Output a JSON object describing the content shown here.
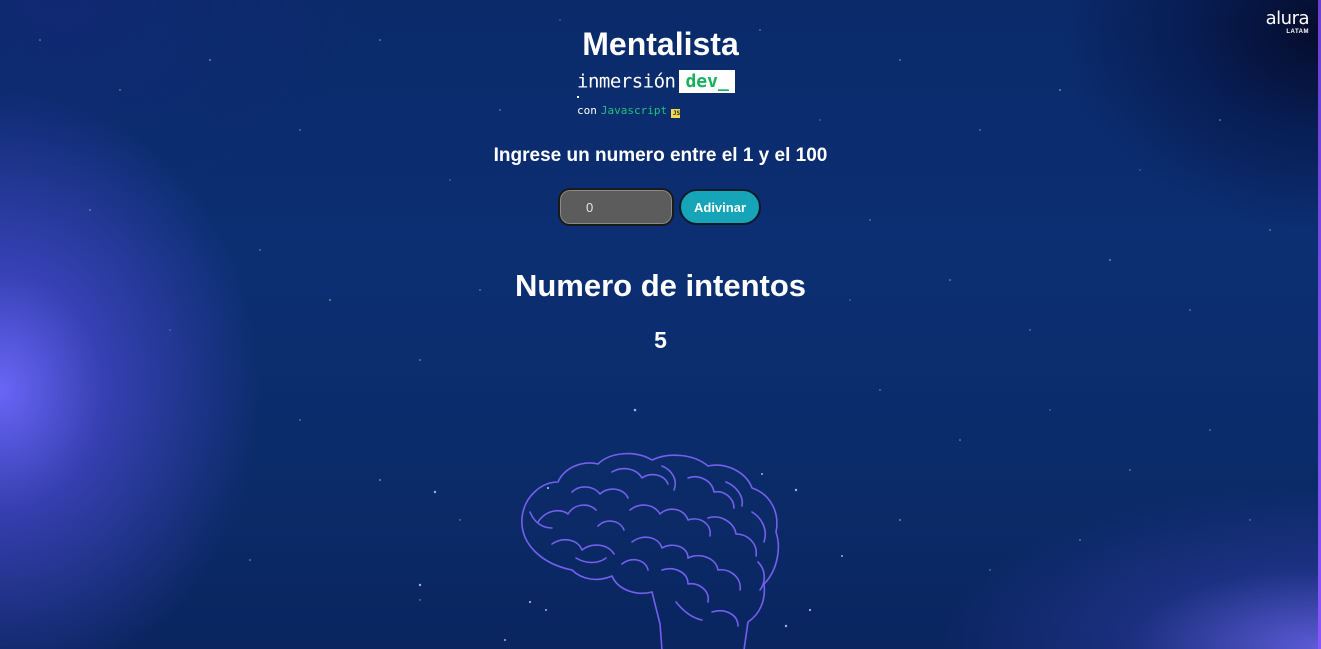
{
  "brand": {
    "logo_word": "alura",
    "logo_sub": "LATAM"
  },
  "header": {
    "title": "Mentalista",
    "event_word": "inmersión",
    "event_badge": "dev_",
    "con_label": "con",
    "language": "Javascript",
    "js_badge": "JS"
  },
  "game": {
    "prompt": "Ingrese un numero entre el 1 y el 100",
    "input_value": "0",
    "guess_button": "Adivinar",
    "attempts_title": "Numero de intentos",
    "attempts_value": "5"
  },
  "colors": {
    "background": "#0c2f73",
    "accent_button": "#15a4b8",
    "dev_green": "#16b15d",
    "js_yellow": "#f0db4f",
    "brain_stroke": "#6f5cf0"
  },
  "icons": {
    "brain": "brain-outline-icon",
    "logo": "alura-logo"
  }
}
